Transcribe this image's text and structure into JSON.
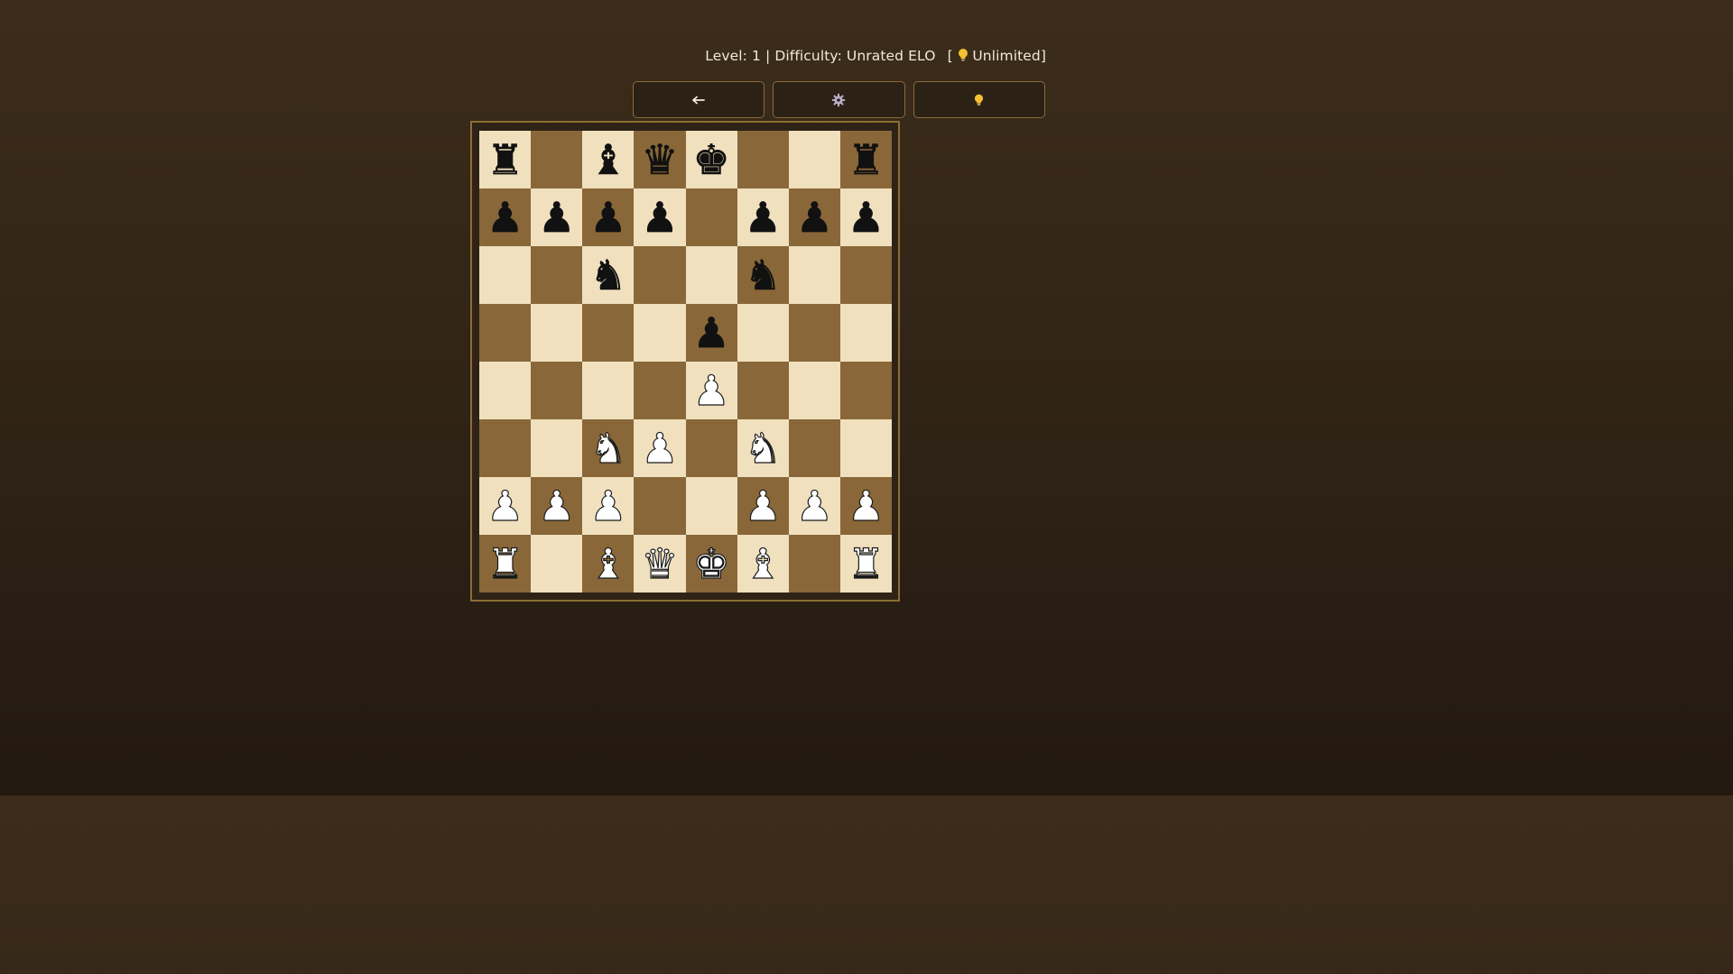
{
  "status": {
    "level_text": "Level: 1 | Difficulty: Unrated ELO",
    "hint_open": "[",
    "hint_icon": "bulb-icon",
    "hint_count": "Unlimited]"
  },
  "toolbar": {
    "buttons": [
      {
        "name": "undo-button",
        "icon": "arrow-left-icon"
      },
      {
        "name": "settings-button",
        "icon": "gear-icon"
      },
      {
        "name": "hint-button",
        "icon": "bulb-icon"
      }
    ]
  },
  "board": {
    "light_color": "#f0e0be",
    "dark_color": "#896738",
    "rows": [
      [
        "r",
        "",
        "b",
        "q",
        "k",
        "",
        "",
        "r"
      ],
      [
        "p",
        "p",
        "p",
        "p",
        "",
        "p",
        "p",
        "p"
      ],
      [
        "",
        "",
        "n",
        "",
        "",
        "n",
        "",
        ""
      ],
      [
        "",
        "",
        "",
        "",
        "p",
        "",
        "",
        ""
      ],
      [
        "",
        "",
        "",
        "",
        "P",
        "",
        "",
        ""
      ],
      [
        "",
        "",
        "N",
        "P",
        "",
        "N",
        "",
        ""
      ],
      [
        "P",
        "P",
        "P",
        "",
        "",
        "P",
        "P",
        "P"
      ],
      [
        "R",
        "",
        "B",
        "Q",
        "K",
        "B",
        "",
        "R"
      ]
    ]
  }
}
